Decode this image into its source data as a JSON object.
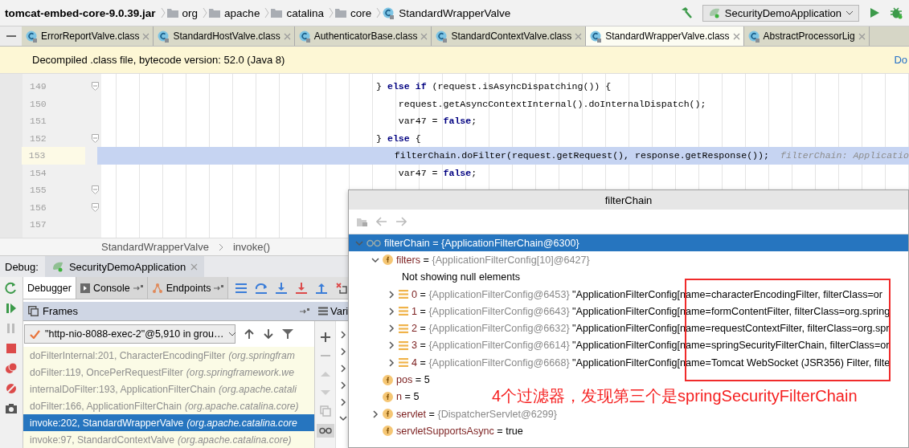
{
  "navbar": {
    "crumbs": [
      {
        "label": "tomcat-embed-core-9.0.39.jar",
        "kind": "jar"
      },
      {
        "label": "org",
        "kind": "package"
      },
      {
        "label": "apache",
        "kind": "package"
      },
      {
        "label": "catalina",
        "kind": "package"
      },
      {
        "label": "core",
        "kind": "package"
      },
      {
        "label": "StandardWrapperValve",
        "kind": "class"
      }
    ],
    "run_config": "SecurityDemoApplication"
  },
  "editor_tabs": [
    {
      "label": "ErrorReportValve.class",
      "selected": false
    },
    {
      "label": "StandardHostValve.class",
      "selected": false
    },
    {
      "label": "AuthenticatorBase.class",
      "selected": false
    },
    {
      "label": "StandardContextValve.class",
      "selected": false
    },
    {
      "label": "StandardWrapperValve.class",
      "selected": true
    },
    {
      "label": "AbstractProcessorLig",
      "selected": false
    }
  ],
  "banner": {
    "text": "Decompiled .class file, bytecode version: 52.0 (Java 8)",
    "link": "Do"
  },
  "code": {
    "lines": [
      {
        "number": "149",
        "text": "} **else if** (request.isAsyncDispatching()) {",
        "fold": true,
        "current": false
      },
      {
        "number": "150",
        "text": "    request.getAsyncContextInternal().doInternalDispatch();",
        "fold": false,
        "current": false
      },
      {
        "number": "151",
        "text": "    var47 = **false**;",
        "fold": false,
        "current": false
      },
      {
        "number": "152",
        "text": "} **else** {",
        "fold": true,
        "current": false
      },
      {
        "number": "153",
        "text": "    filterChain.doFilter(request.getRequest(), response.getResponse());",
        "hint": "filterChain: Applicatio",
        "fold": false,
        "current": true
      },
      {
        "number": "154",
        "text": "    var47 = **false**;",
        "fold": false,
        "current": false
      },
      {
        "number": "155",
        "fold": true,
        "current": false
      },
      {
        "number": "156",
        "fold": true,
        "current": false
      },
      {
        "number": "157",
        "fold": false,
        "current": false
      }
    ]
  },
  "editor_breadcrumb": [
    "StandardWrapperValve",
    "invoke()"
  ],
  "debug": {
    "label": "Debug:",
    "session": "SecurityDemoApplication",
    "tabs": [
      {
        "label": "Debugger",
        "kind": "debugger",
        "selected": true
      },
      {
        "label": "Console",
        "kind": "console",
        "selected": false
      },
      {
        "label": "Endpoints",
        "kind": "endpoints",
        "selected": false
      }
    ],
    "frames_title": "Frames",
    "variables_title": "Vari",
    "thread": "\"http-nio-8088-exec-2\"@5,910 in grou…",
    "frames": [
      {
        "method": "doFilterInternal:201, CharacterEncodingFilter",
        "package": "(org.springfram",
        "selected": false
      },
      {
        "method": "doFilter:119, OncePerRequestFilter",
        "package": "(org.springframework.we",
        "selected": false
      },
      {
        "method": "internalDoFilter:193, ApplicationFilterChain",
        "package": "(org.apache.catali",
        "selected": false
      },
      {
        "method": "doFilter:166, ApplicationFilterChain",
        "package": "(org.apache.catalina.core)",
        "selected": false
      },
      {
        "method": "invoke:202, StandardWrapperValve",
        "package": "(org.apache.catalina.core",
        "selected": true
      },
      {
        "method": "invoke:97, StandardContextValve",
        "package": "(org.apache.catalina.core)",
        "selected": false
      }
    ]
  },
  "popup": {
    "title": "filterChain",
    "tree": [
      {
        "kind": "object",
        "name": "filterChain",
        "op": "=",
        "ref": "{ApplicationFilterChain@6300}",
        "expanded": true,
        "selected": true,
        "children": [
          {
            "kind": "field",
            "name": "filters",
            "op": "=",
            "ref": "{ApplicationFilterConfig[10]@6427}",
            "expanded": true,
            "selected": false,
            "children": [
              {
                "kind": "note",
                "text": "Not showing null elements",
                "selected": false
              },
              {
                "kind": "element",
                "name": "0",
                "op": "=",
                "ref": "{ApplicationFilterConfig@6453}",
                "string": "\"ApplicationFilterConfig[name=characterEncodingFilter, filterClass=or",
                "expanded": false,
                "selected": false
              },
              {
                "kind": "element",
                "name": "1",
                "op": "=",
                "ref": "{ApplicationFilterConfig@6643}",
                "string": "\"ApplicationFilterConfig[name=formContentFilter, filterClass=org.spring",
                "expanded": false,
                "selected": false
              },
              {
                "kind": "element",
                "name": "2",
                "op": "=",
                "ref": "{ApplicationFilterConfig@6632}",
                "string": "\"ApplicationFilterConfig[name=requestContextFilter, filterClass=org.spr",
                "expanded": false,
                "selected": false
              },
              {
                "kind": "element",
                "name": "3",
                "op": "=",
                "ref": "{ApplicationFilterConfig@6614}",
                "string": "\"ApplicationFilterConfig[name=springSecurityFilterChain, filterClass=or",
                "expanded": false,
                "selected": false
              },
              {
                "kind": "element",
                "name": "4",
                "op": "=",
                "ref": "{ApplicationFilterConfig@6668}",
                "string": "\"ApplicationFilterConfig[name=Tomcat WebSocket (JSR356) Filter, filte",
                "expanded": false,
                "selected": false
              }
            ]
          },
          {
            "kind": "field",
            "name": "pos",
            "op": "=",
            "value": "5",
            "selected": false
          },
          {
            "kind": "field",
            "name": "n",
            "op": "=",
            "value": "5",
            "selected": false
          },
          {
            "kind": "field",
            "name": "servlet",
            "op": "=",
            "ref": "{DispatcherServlet@6299}",
            "expanded": false,
            "selected": false
          },
          {
            "kind": "field",
            "name": "servletSupportsAsync",
            "op": "=",
            "value": "true",
            "selected": false
          }
        ]
      }
    ],
    "annotation": "4个过滤器，发现第三个是springSecurityFilterChain"
  }
}
